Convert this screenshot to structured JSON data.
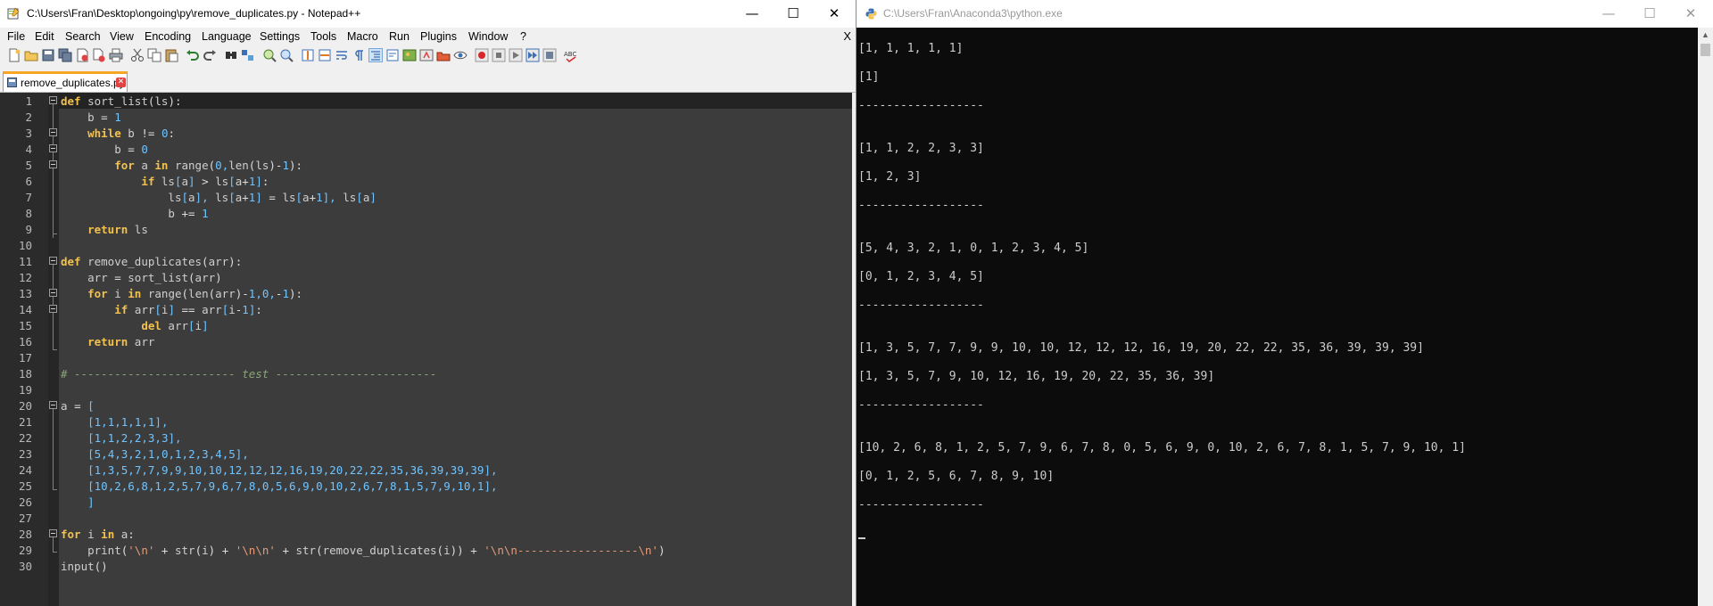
{
  "notepad": {
    "title": "C:\\Users\\Fran\\Desktop\\ongoing\\py\\remove_duplicates.py - Notepad++",
    "window_buttons": {
      "minimize": "—",
      "maximize": "☐",
      "close": "✕"
    },
    "menu": [
      "File",
      "Edit",
      "Search",
      "View",
      "Encoding",
      "Language",
      "Settings",
      "Tools",
      "Macro",
      "Run",
      "Plugins",
      "Window",
      "?"
    ],
    "menu_close": "X",
    "tab": {
      "label": "remove_duplicates.py",
      "close": "✕"
    },
    "line_numbers": [
      "1",
      "2",
      "3",
      "4",
      "5",
      "6",
      "7",
      "8",
      "9",
      "10",
      "11",
      "12",
      "13",
      "14",
      "15",
      "16",
      "17",
      "18",
      "19",
      "20",
      "21",
      "22",
      "23",
      "24",
      "25",
      "26",
      "27",
      "28",
      "29",
      "30"
    ],
    "code": [
      "def sort_list(ls):",
      "    b = 1",
      "    while b != 0:",
      "        b = 0",
      "        for a in range(0,len(ls)-1):",
      "            if ls[a] > ls[a+1]:",
      "                ls[a], ls[a+1] = ls[a+1], ls[a]",
      "                b += 1",
      "    return ls",
      "",
      "def remove_duplicates(arr):",
      "    arr = sort_list(arr)",
      "    for i in range(len(arr)-1,0,-1):",
      "        if arr[i] == arr[i-1]:",
      "            del arr[i]",
      "    return arr",
      "",
      "# ------------------------ test ------------------------",
      "",
      "a = [",
      "    [1,1,1,1,1],",
      "    [1,1,2,2,3,3],",
      "    [5,4,3,2,1,0,1,2,3,4,5],",
      "    [1,3,5,7,7,9,9,10,10,12,12,12,16,19,20,22,22,35,36,39,39,39],",
      "    [10,2,6,8,1,2,5,7,9,6,7,8,0,5,6,9,0,10,2,6,7,8,1,5,7,9,10,1],",
      "    ]",
      "",
      "for i in a:",
      "    print('\\n' + str(i) + '\\n\\n' + str(remove_duplicates(i)) + '\\n\\n------------------\\n')",
      "input()"
    ],
    "colors": {
      "keyword": "#f2c14e",
      "number": "#6fc4ff",
      "string": "#e49c78",
      "comment": "#8ba57a",
      "text": "#dcdcdc",
      "background": "#3c3c3c"
    }
  },
  "console": {
    "title": "C:\\Users\\Fran\\Anaconda3\\python.exe",
    "window_buttons": {
      "minimize": "—",
      "maximize": "☐",
      "close": "✕"
    },
    "lines": [
      "[1, 1, 1, 1, 1]",
      "[1]",
      "------------------",
      "[1, 1, 2, 2, 3, 3]",
      "[1, 2, 3]",
      "------------------",
      "[5, 4, 3, 2, 1, 0, 1, 2, 3, 4, 5]",
      "[0, 1, 2, 3, 4, 5]",
      "------------------",
      "[1, 3, 5, 7, 7, 9, 9, 10, 10, 12, 12, 12, 16, 19, 20, 22, 22, 35, 36, 39, 39, 39]",
      "[1, 3, 5, 7, 9, 10, 12, 16, 19, 20, 22, 35, 36, 39]",
      "------------------",
      "[10, 2, 6, 8, 1, 2, 5, 7, 9, 6, 7, 8, 0, 5, 6, 9, 0, 10, 2, 6, 7, 8, 1, 5, 7, 9, 10, 1]",
      "[0, 1, 2, 5, 6, 7, 8, 9, 10]",
      "------------------"
    ]
  }
}
